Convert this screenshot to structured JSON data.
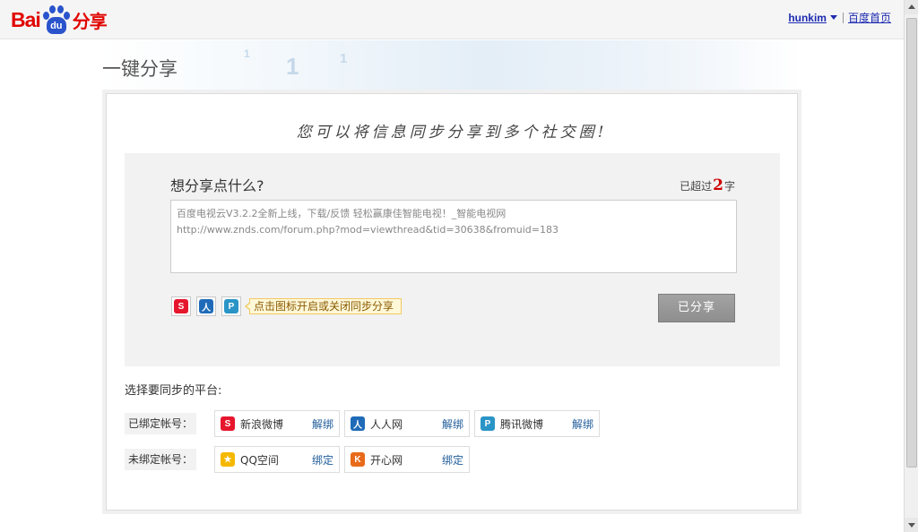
{
  "header": {
    "logo_text": "Bai",
    "logo_paw_text": "du",
    "logo_suffix": "分享",
    "username": "hunkim",
    "home_link": "百度首页"
  },
  "banner": {
    "title": "一键分享",
    "bubbles": [
      "1",
      "1",
      "1"
    ]
  },
  "card": {
    "slogan": "您可以将信息同步分享到多个社交圈!",
    "compose": {
      "question": "想分享点什么?",
      "count_prefix": "已超过",
      "count_value": "2",
      "count_suffix": "字",
      "text_line1": "百度电视云V3.2.2全新上线，下载/反馈 轻松赢康佳智能电视！_智能电视网",
      "text_line2": "http://www.znds.com/forum.php?mod=viewthread&tid=30638&fromuid=183",
      "tip": "点击图标开启或关闭同步分享",
      "share_button": "已分享"
    },
    "platforms_title": "选择要同步的平台:",
    "bound": {
      "label": "已绑定帐号：",
      "accounts": [
        {
          "name": "新浪微博",
          "action": "解绑",
          "icon": "sina-weibo-icon",
          "color": "#e6162d",
          "glyph": "S"
        },
        {
          "name": "人人网",
          "action": "解绑",
          "icon": "renren-icon",
          "color": "#1f6bb8",
          "glyph": "人"
        },
        {
          "name": "腾讯微博",
          "action": "解绑",
          "icon": "tencent-weibo-icon",
          "color": "#2a94c7",
          "glyph": "P"
        }
      ]
    },
    "unbound": {
      "label": "未绑定帐号：",
      "accounts": [
        {
          "name": "QQ空间",
          "action": "绑定",
          "icon": "qzone-icon",
          "color": "#f5b800",
          "glyph": "★"
        },
        {
          "name": "开心网",
          "action": "绑定",
          "icon": "kaixin-icon",
          "color": "#e86a1a",
          "glyph": "K"
        }
      ]
    }
  }
}
